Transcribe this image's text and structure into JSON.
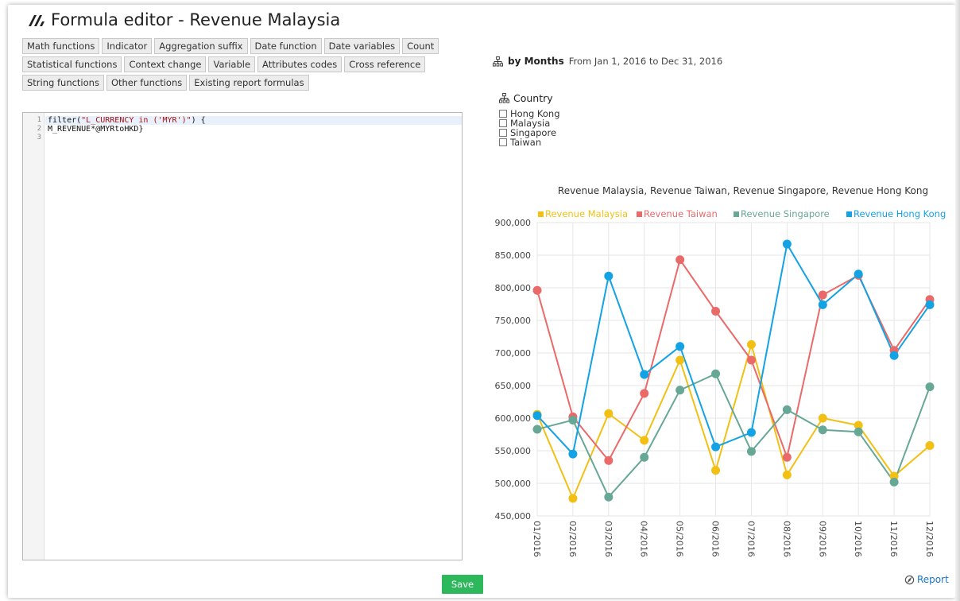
{
  "window": {
    "title": "Formula editor - Revenue Malaysia",
    "logo_icon": "speedometer-icon"
  },
  "function_buttons": [
    [
      "Math functions",
      "Indicator",
      "Aggregation suffix",
      "Date function",
      "Date variables",
      "Count"
    ],
    [
      "Statistical functions",
      "Context change",
      "Variable",
      "Attributes codes",
      "Cross reference"
    ],
    [
      "String functions",
      "Other functions",
      "Existing report formulas"
    ]
  ],
  "editor": {
    "line_numbers": [
      "1",
      "2",
      "3"
    ],
    "lines": [
      {
        "parts": [
          {
            "t": "filter(",
            "c": "kw"
          },
          {
            "t": "\"L_CURRENCY in ('MYR')\"",
            "c": "str"
          },
          {
            "t": ") {",
            "c": "kw"
          }
        ]
      },
      {
        "parts": [
          {
            "t": "M_REVENUE*@MYRtoHKD}",
            "c": "kw"
          }
        ]
      },
      {
        "parts": []
      }
    ]
  },
  "report": {
    "dimension_label": "by Months",
    "date_range": "From Jan 1, 2016 to Dec 31, 2016",
    "hierarchy_icon": "hierarchy-icon"
  },
  "country_filter": {
    "title": "Country",
    "options": [
      "Hong Kong",
      "Malaysia",
      "Singapore",
      "Taiwan"
    ]
  },
  "chart_data": {
    "type": "line",
    "title": "Revenue Malaysia, Revenue Taiwan, Revenue Singapore, Revenue Hong Kong",
    "categories": [
      "01/2016",
      "02/2016",
      "03/2016",
      "04/2016",
      "05/2016",
      "06/2016",
      "07/2016",
      "08/2016",
      "09/2016",
      "10/2016",
      "11/2016",
      "12/2016"
    ],
    "ylim": [
      450000,
      900000
    ],
    "yticks": [
      450000,
      500000,
      550000,
      600000,
      650000,
      700000,
      750000,
      800000,
      850000,
      900000
    ],
    "ytick_labels": [
      "450,000",
      "500,000",
      "550,000",
      "600,000",
      "650,000",
      "700,000",
      "750,000",
      "800,000",
      "850,000",
      "900,000"
    ],
    "legend_position": "top",
    "grid": true,
    "series": [
      {
        "name": "Revenue Malaysia",
        "color": "#f2c012",
        "values": [
          606000,
          477000,
          607000,
          566000,
          689000,
          520000,
          713000,
          513000,
          600000,
          589000,
          511000,
          558000
        ]
      },
      {
        "name": "Revenue Taiwan",
        "color": "#ea6a6a",
        "values": [
          796000,
          602000,
          535000,
          638000,
          843000,
          764000,
          689000,
          540000,
          789000,
          819000,
          704000,
          782000
        ]
      },
      {
        "name": "Revenue Singapore",
        "color": "#67a796",
        "values": [
          583000,
          597000,
          479000,
          540000,
          643000,
          668000,
          549000,
          613000,
          582000,
          579000,
          502000,
          648000
        ]
      },
      {
        "name": "Revenue Hong Kong",
        "color": "#13a2e3",
        "values": [
          604000,
          545000,
          818000,
          667000,
          710000,
          556000,
          578000,
          867000,
          774000,
          821000,
          696000,
          774000
        ]
      }
    ]
  },
  "actions": {
    "save_label": "Save",
    "report_label": "Report",
    "report_icon": "compass-icon"
  }
}
